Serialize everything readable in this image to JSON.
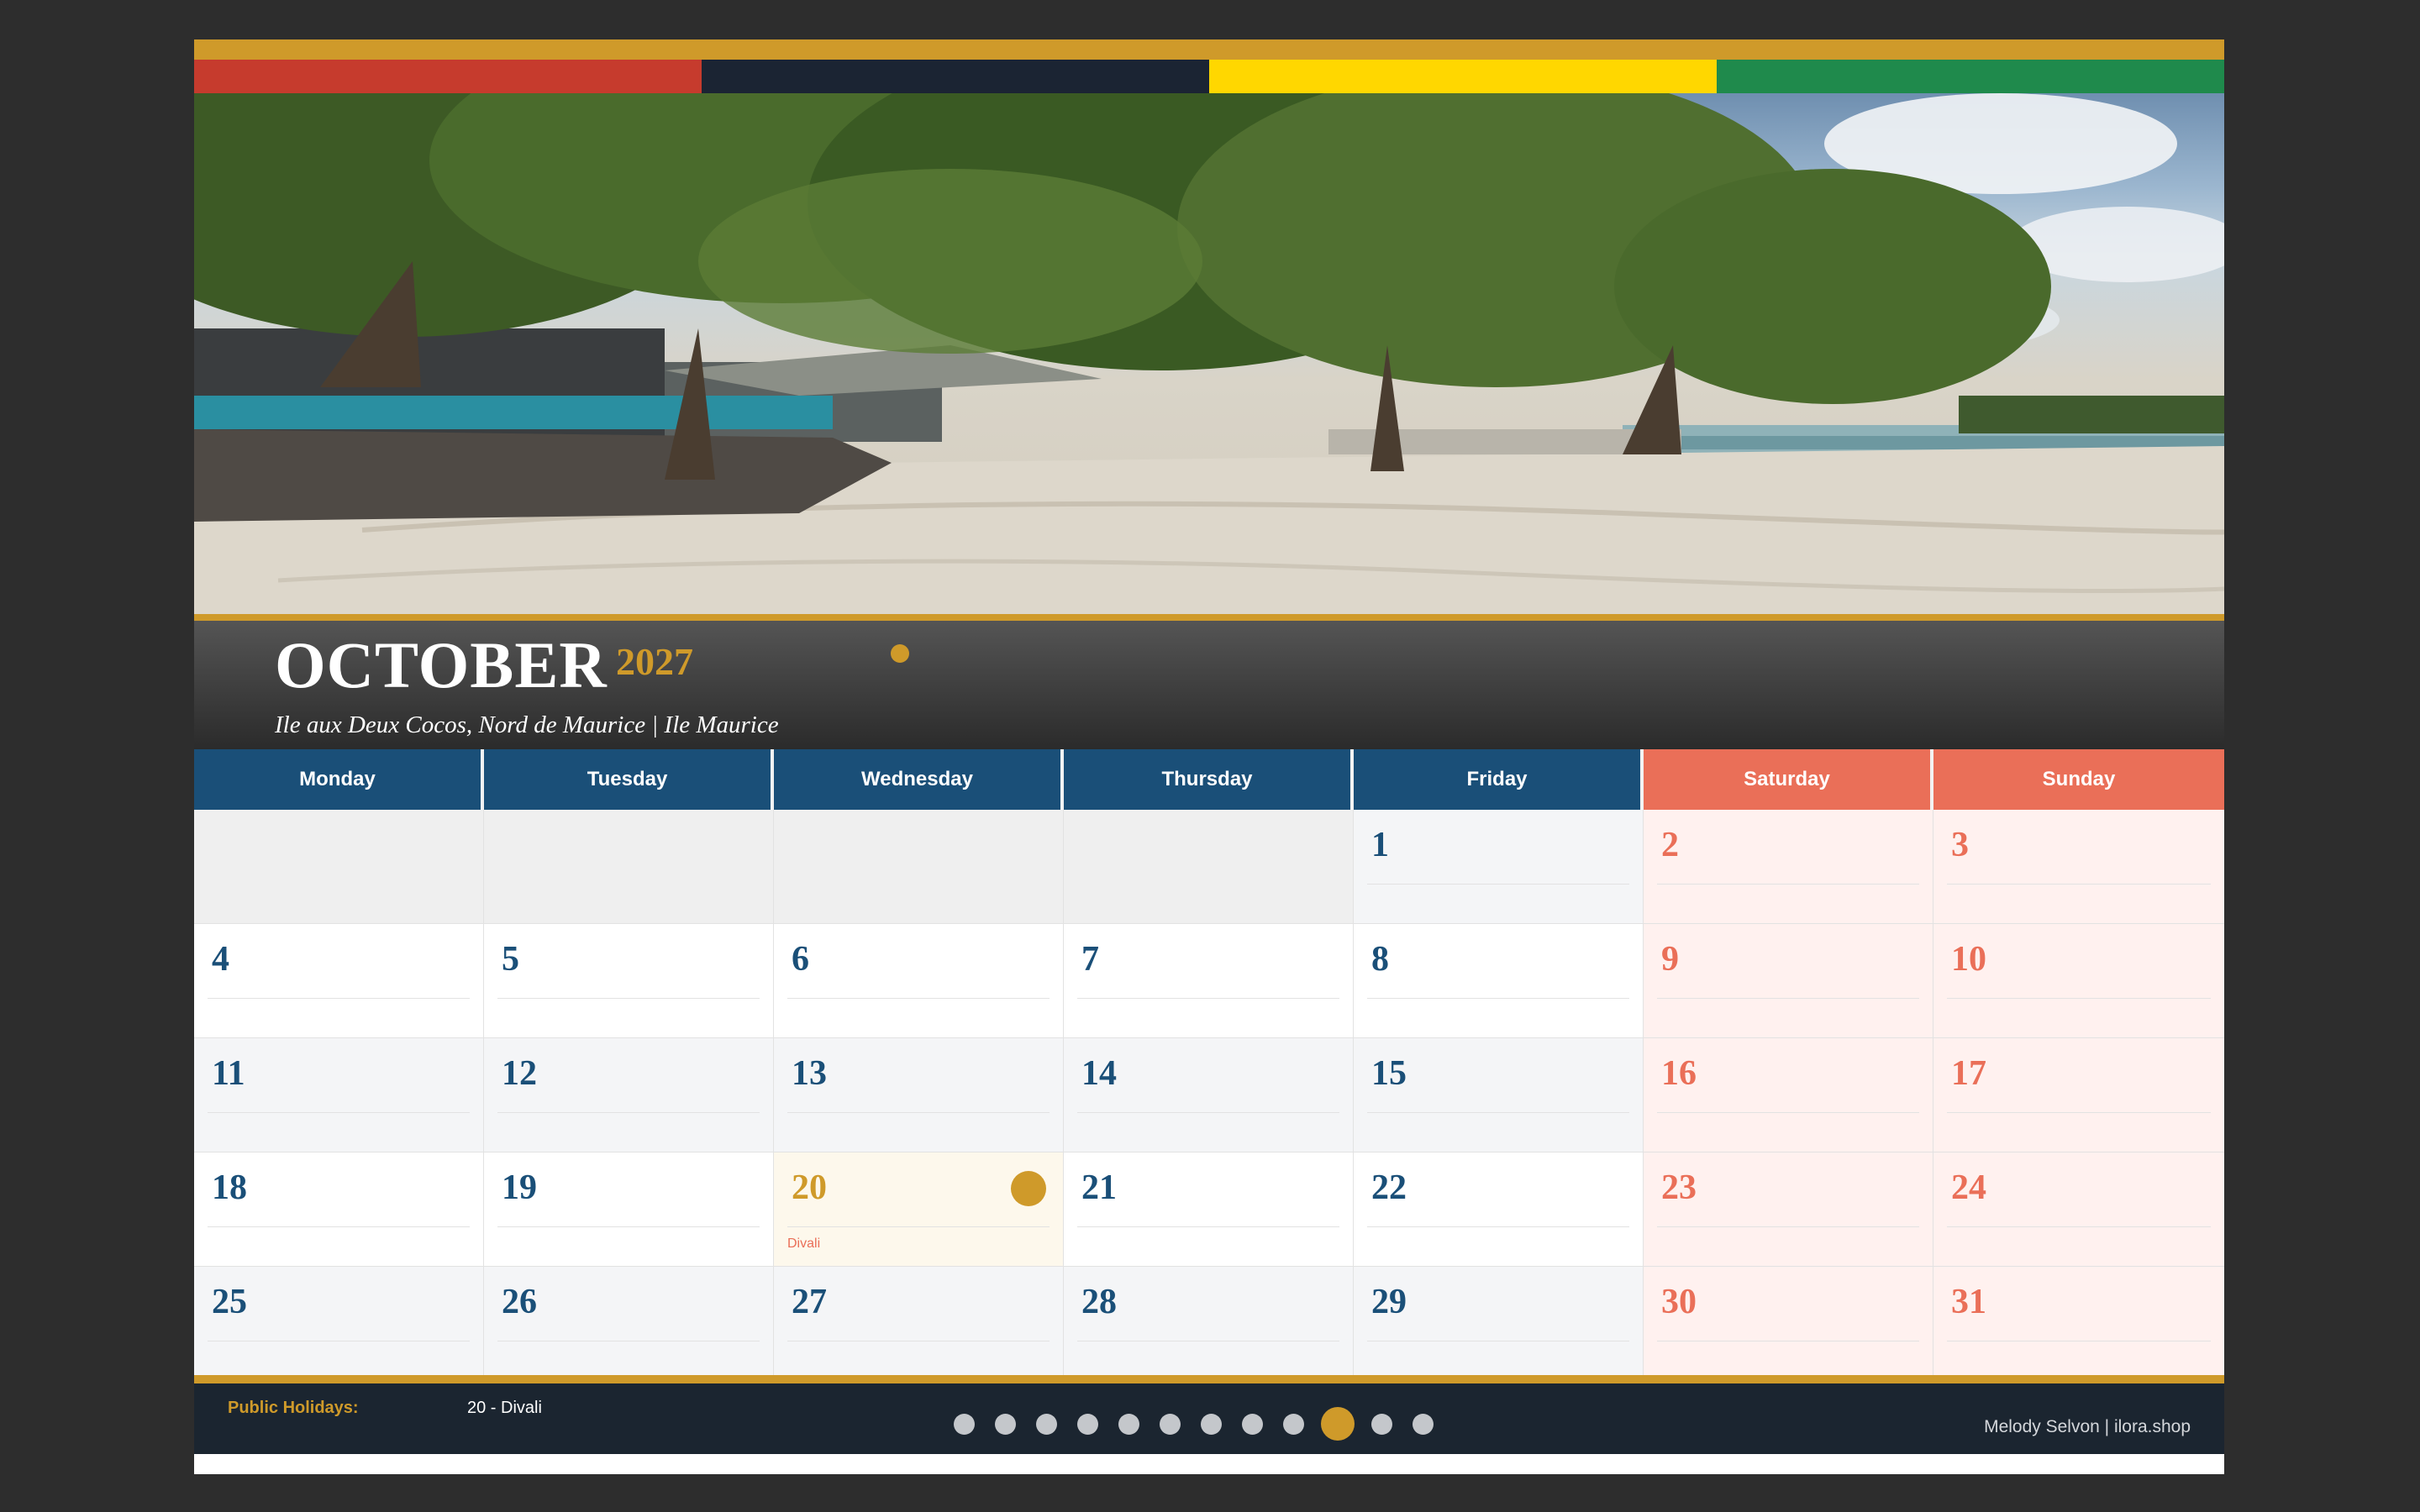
{
  "colors": {
    "gold": "#cf9a2a",
    "navy": "#1a4f78",
    "coral": "#ea6f58",
    "flag": [
      "#c63b2d",
      "#1b2433",
      "#ffd700",
      "#1f8a4c"
    ]
  },
  "header": {
    "month": "OCTOBER",
    "year": "2027",
    "location": "Ile aux Deux Cocos, Nord de Maurice  |  Ile Maurice"
  },
  "days": [
    "Monday",
    "Tuesday",
    "Wednesday",
    "Thursday",
    "Friday",
    "Saturday",
    "Sunday"
  ],
  "weeks": [
    [
      "",
      "",
      "",
      "",
      "1",
      "2",
      "3"
    ],
    [
      "4",
      "5",
      "6",
      "7",
      "8",
      "9",
      "10"
    ],
    [
      "11",
      "12",
      "13",
      "14",
      "15",
      "16",
      "17"
    ],
    [
      "18",
      "19",
      "20",
      "21",
      "22",
      "23",
      "24"
    ],
    [
      "25",
      "26",
      "27",
      "28",
      "29",
      "30",
      "31"
    ]
  ],
  "holiday": {
    "day": "20",
    "label": "Divali"
  },
  "footer": {
    "holidays_label": "Public Holidays:",
    "holidays_value": "20 - Divali",
    "credit": "Melody Selvon  |  ilora.shop",
    "page_count": 12,
    "active_page": 10
  }
}
